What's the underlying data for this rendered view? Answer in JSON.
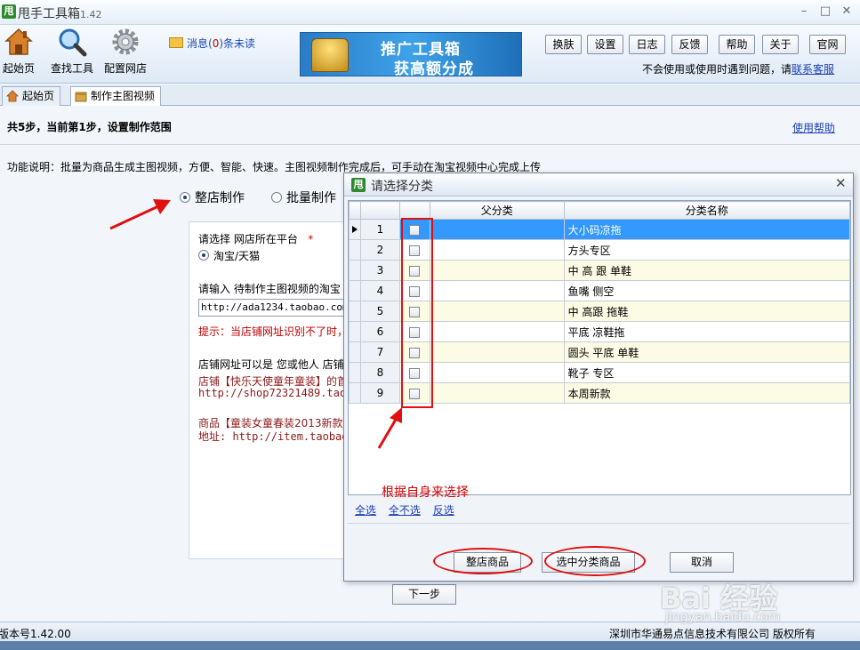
{
  "app": {
    "title": "甩手工具箱",
    "version": "1.42",
    "icon_char": "甩"
  },
  "window_controls": {
    "minimize": "–",
    "maximize": "□",
    "close": "✕"
  },
  "toolbar": {
    "home_label": "起始页",
    "find_label": "查找工具",
    "config_label": "配置网店",
    "message_prefix": "消息(",
    "message_count": "0",
    "message_suffix": ")条未读",
    "banner_line1": "推广工具箱",
    "banner_line2": "获高额分成",
    "buttons": [
      "换肤",
      "设置",
      "日志",
      "反馈",
      "帮助",
      "关于",
      "官网"
    ],
    "help_text": "不会使用或使用时遇到问题，请",
    "help_link": "联系客服"
  },
  "tabs": [
    {
      "label": "起始页"
    },
    {
      "label": "制作主图视频"
    }
  ],
  "main": {
    "steps": "共5步，当前第1步，设置制作范围",
    "use_help": "使用帮助",
    "function_desc": "功能说明：批量为商品生成主图视频，方便、智能、快速。主图视频制作完成后，可手动在淘宝视频中心完成上传",
    "mode_shop": "整店制作",
    "mode_batch": "批量制作",
    "platform_label": "请选择 网店所在平台",
    "required_mark": "*",
    "platform_option": "淘宝/天猫",
    "url_prompt": "请输入 待制作主图视频的淘宝",
    "url_value": "http://ada1234.taobao.com/?",
    "hint": "提示：当店铺网址识别不了时，",
    "shop_note": "店铺网址可以是 您或他人 店铺",
    "example_shop": "店铺【快乐天使童年童装】的首",
    "example_shop_url": "http://shop72321489.taobao",
    "example_item": "商品【童装女童春装2013新款",
    "example_item_url": "地址: http://item.taobao.com",
    "next_button": "下一步"
  },
  "dialog": {
    "title": "请选择分类",
    "icon_char": "甩",
    "close": "✕",
    "columns": [
      "父分类",
      "分类名称"
    ],
    "rows": [
      {
        "num": "1",
        "parent": "",
        "name": "大小码凉拖"
      },
      {
        "num": "2",
        "parent": "",
        "name": "方头专区"
      },
      {
        "num": "3",
        "parent": "",
        "name": "中 高 跟 单鞋"
      },
      {
        "num": "4",
        "parent": "",
        "name": "鱼嘴 侧空"
      },
      {
        "num": "5",
        "parent": "",
        "name": "中 高跟 拖鞋"
      },
      {
        "num": "6",
        "parent": "",
        "name": "平底 凉鞋拖"
      },
      {
        "num": "7",
        "parent": "",
        "name": "圆头 平底 单鞋"
      },
      {
        "num": "8",
        "parent": "",
        "name": "靴子 专区"
      },
      {
        "num": "9",
        "parent": "",
        "name": "本周新款"
      }
    ],
    "annotation": "根据自身来选择",
    "select_all": "全选",
    "select_none": "全不选",
    "invert": "反选",
    "btn_whole_shop": "整店商品",
    "btn_selected": "选中分类商品",
    "btn_cancel": "取消"
  },
  "status": {
    "version_text": "版本号1.42.00",
    "company": "深圳市华通易点信息技术有限公司 版权所有"
  },
  "watermark": {
    "brand": "Bai 经验",
    "sub": "jingyan.baidu.com"
  },
  "colors": {
    "accent_blue": "#3399ff",
    "annotation_red": "#e01010",
    "link_blue": "#1c3fb5"
  }
}
